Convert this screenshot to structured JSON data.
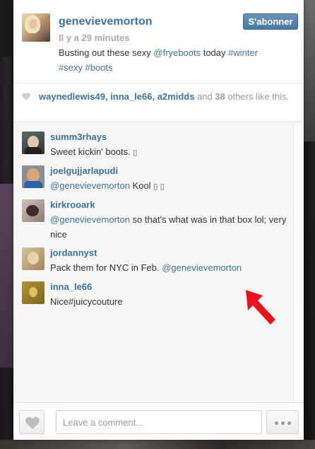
{
  "post": {
    "author": "genevievemorton",
    "time": "Il y a 29 minutes",
    "caption": {
      "prefix": "Busting out these sexy ",
      "mention": "@fryeboots",
      "middle": " today ",
      "tag1": "#winter",
      "tag2": "#sexy",
      "tag3": "#boots"
    },
    "follow_label": "S'abonner"
  },
  "likes": {
    "user1": "waynedlewis49",
    "user2": "inna_le66",
    "user3": "a2midds",
    "and_text": " and ",
    "count": "38",
    "suffix": " others like this."
  },
  "comments": [
    {
      "user": "summ3rhays",
      "text": "Sweet kickin' boots. ",
      "glyph": "▯"
    },
    {
      "user": "joelgujjarlapudi",
      "mention": "@genevievemorton",
      "text": " Kool ",
      "glyph": "▯ ▯"
    },
    {
      "user": "kirkrooark",
      "mention": "@genevievemorton",
      "text": " so that's what was in that box lol; very nice"
    },
    {
      "user": "jordannyst",
      "text": "Pack them for NYC in Feb. ",
      "mention": "@genevievemorton"
    },
    {
      "user": "inna_le66",
      "text": "Nice#juicycouture"
    }
  ],
  "footer": {
    "comment_placeholder": "Leave a comment..."
  },
  "colors": {
    "link": "#3f729b",
    "follow_button": "#517fa4",
    "annotation_arrow": "#e8141b"
  },
  "icons": [
    "heart-icon",
    "more-dots-icon",
    "red-arrow-icon"
  ]
}
